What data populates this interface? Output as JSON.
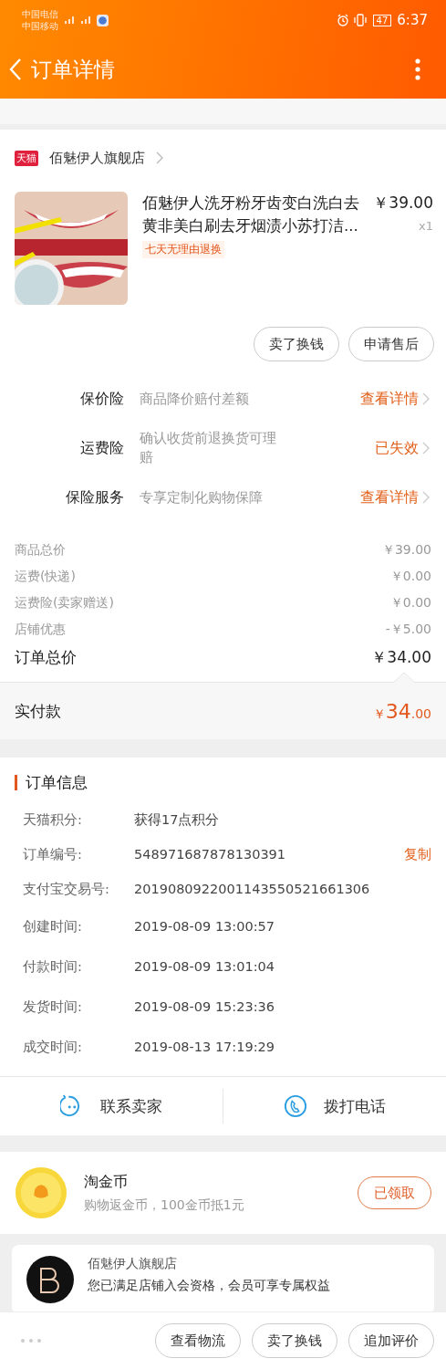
{
  "status_bar": {
    "carriers": [
      "中国电信",
      "中国移动"
    ],
    "battery": "47",
    "time": "6:37"
  },
  "header": {
    "title": "订单详情"
  },
  "shop": {
    "badge": "天猫",
    "name": "佰魅伊人旗舰店"
  },
  "product": {
    "title": "佰魅伊人洗牙粉牙齿变白洗白去黄非美白刷去牙烟渍小苏打洁...",
    "price": "￥39.00",
    "quantity": "x1",
    "tag": "七天无理由退换"
  },
  "product_actions": [
    "卖了换钱",
    "申请售后"
  ],
  "services": [
    {
      "label": "保价险",
      "desc": "商品降价赔付差额",
      "action": "查看详情"
    },
    {
      "label": "运费险",
      "desc": "确认收货前退换货可理赔",
      "action": "已失效"
    },
    {
      "label": "保险服务",
      "desc": "专享定制化购物保障",
      "action": "查看详情"
    }
  ],
  "price_rows": [
    {
      "label": "商品总价",
      "value": "￥39.00",
      "kind": "minor"
    },
    {
      "label": "运费(快递)",
      "value": "￥0.00",
      "kind": "minor"
    },
    {
      "label": "运费险(卖家赠送)",
      "value": "￥0.00",
      "kind": "minor"
    },
    {
      "label": "店铺优惠",
      "value": "-￥5.00",
      "kind": "minor"
    },
    {
      "label": "订单总价",
      "value": "￥34.00",
      "kind": "total"
    }
  ],
  "paid": {
    "label": "实付款",
    "currency": "￥",
    "integer": "34",
    "decimal": ".00"
  },
  "order_info": {
    "title": "订单信息",
    "rows": [
      {
        "label": "天猫积分:",
        "value": "获得17点积分"
      },
      {
        "label": "订单编号:",
        "value": "548971687878130391",
        "action": "复制"
      },
      {
        "label": "支付宝交易号:",
        "value": "2019080922001143550521661306"
      },
      {
        "label": "创建时间:",
        "value": "2019-08-09 13:00:57"
      },
      {
        "label": "付款时间:",
        "value": "2019-08-09 13:01:04"
      },
      {
        "label": "发货时间:",
        "value": "2019-08-09 15:23:36"
      },
      {
        "label": "成交时间:",
        "value": "2019-08-13 17:19:29"
      }
    ]
  },
  "contact": [
    {
      "label": "联系卖家",
      "kind": "chat"
    },
    {
      "label": "拨打电话",
      "kind": "phone"
    }
  ],
  "coins": {
    "title": "淘金币",
    "subtitle": "购物返金币，100金币抵1元",
    "button": "已领取"
  },
  "member_card": {
    "shop": "佰魅伊人旗舰店",
    "text": "您已满足店铺入会资格，会员可享专属权益"
  },
  "bottom_bar": {
    "buttons": [
      "查看物流",
      "卖了换钱",
      "追加评价"
    ]
  }
}
